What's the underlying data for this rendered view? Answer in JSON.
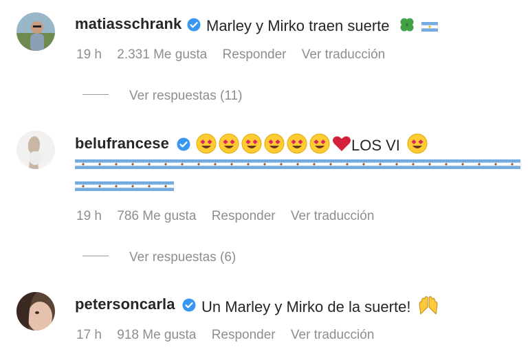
{
  "comments": [
    {
      "username": "matiasschrank",
      "text": "Marley y Mirko traen suerte",
      "time": "19 h",
      "likes": "2.331 Me gusta",
      "reply": "Responder",
      "translate": "Ver traducción",
      "view_replies": "Ver respuestas (11)",
      "emoji": [
        "four-leaf-clover",
        "argentina-flag"
      ]
    },
    {
      "username": "belufrancese",
      "text": "LOS VI",
      "time": "19 h",
      "likes": "786 Me gusta",
      "reply": "Responder",
      "translate": "Ver traducción",
      "view_replies": "Ver respuestas (6)",
      "emoji": [
        "heart-eyes-face",
        "red-heart",
        "argentina-flag"
      ]
    },
    {
      "username": "petersoncarla",
      "text": "Un Marley y Mirko de la suerte!",
      "time": "17 h",
      "likes": "918 Me gusta",
      "reply": "Responder",
      "translate": "Ver traducción",
      "emoji": [
        "raising-hands"
      ]
    }
  ],
  "colors": {
    "text": "#262626",
    "meta": "#8e8e8e",
    "verified": "#3897f0",
    "flag_blue": "#74acdf",
    "heart": "#e0245e"
  }
}
